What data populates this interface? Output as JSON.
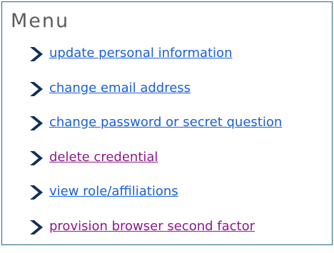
{
  "menu": {
    "title": "Menu",
    "colors": {
      "link": "#1a5fd6",
      "visited": "#8a1a8a",
      "chevron": "#10305a",
      "border": "#1f6b7a"
    },
    "items": [
      {
        "label": "update personal information",
        "state": "link",
        "icon": "chevron-right-icon"
      },
      {
        "label": "change email address",
        "state": "link",
        "icon": "chevron-right-icon"
      },
      {
        "label": "change password or secret question",
        "state": "link",
        "icon": "chevron-right-icon"
      },
      {
        "label": "delete credential",
        "state": "visited",
        "icon": "chevron-right-icon"
      },
      {
        "label": "view role/affiliations",
        "state": "link",
        "icon": "chevron-right-icon"
      },
      {
        "label": "provision browser second factor",
        "state": "visited",
        "icon": "chevron-right-icon"
      }
    ]
  }
}
